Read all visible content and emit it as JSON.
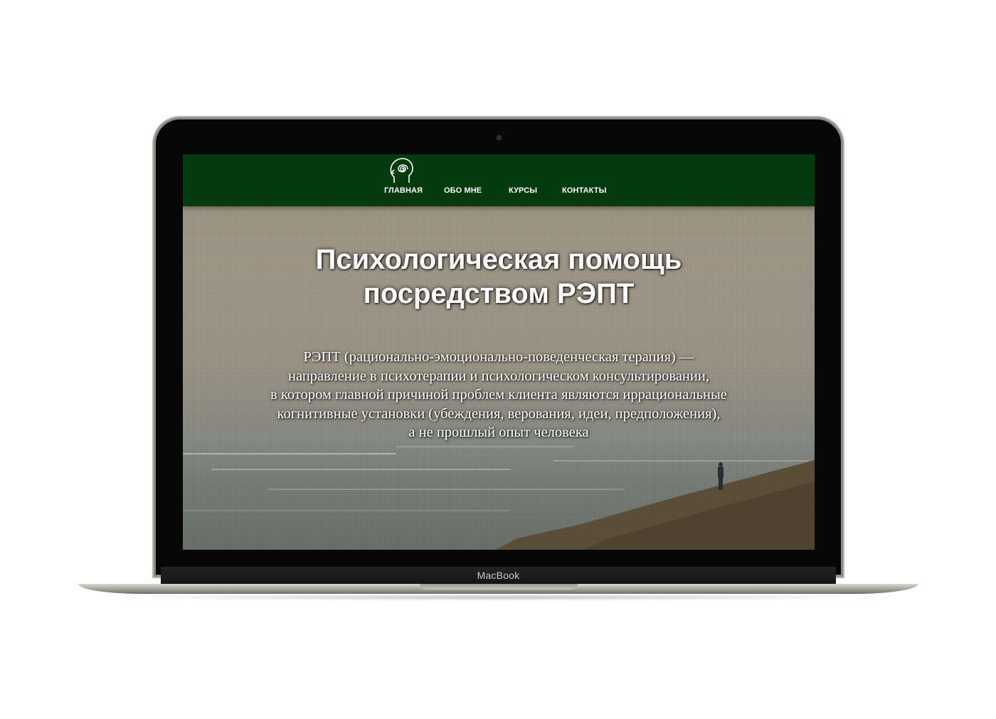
{
  "device": {
    "brand_label": "MacBook"
  },
  "site": {
    "logo_icon": "head-spiral-icon",
    "nav": [
      {
        "label": "ГЛАВНАЯ"
      },
      {
        "label": "ОБО МНЕ"
      },
      {
        "label": "КУРСЫ"
      },
      {
        "label": "КОНТАКТЫ"
      }
    ],
    "hero": {
      "title_lines": [
        "Психологическая помощь",
        "посредством РЭПТ"
      ],
      "text_lines": [
        "РЭПТ (рационально-эмоционально-поведенческая терапия) —",
        "направление в психотерапии и психологическом консультировании,",
        "в котором главной причиной проблем клиента являются иррациональные",
        "когнитивные установки (убеждения, верования, идеи, предположения),",
        "а не прошлый опыт человека"
      ]
    },
    "colors": {
      "header_bg": "#033b0f",
      "text": "#ffffff"
    }
  }
}
